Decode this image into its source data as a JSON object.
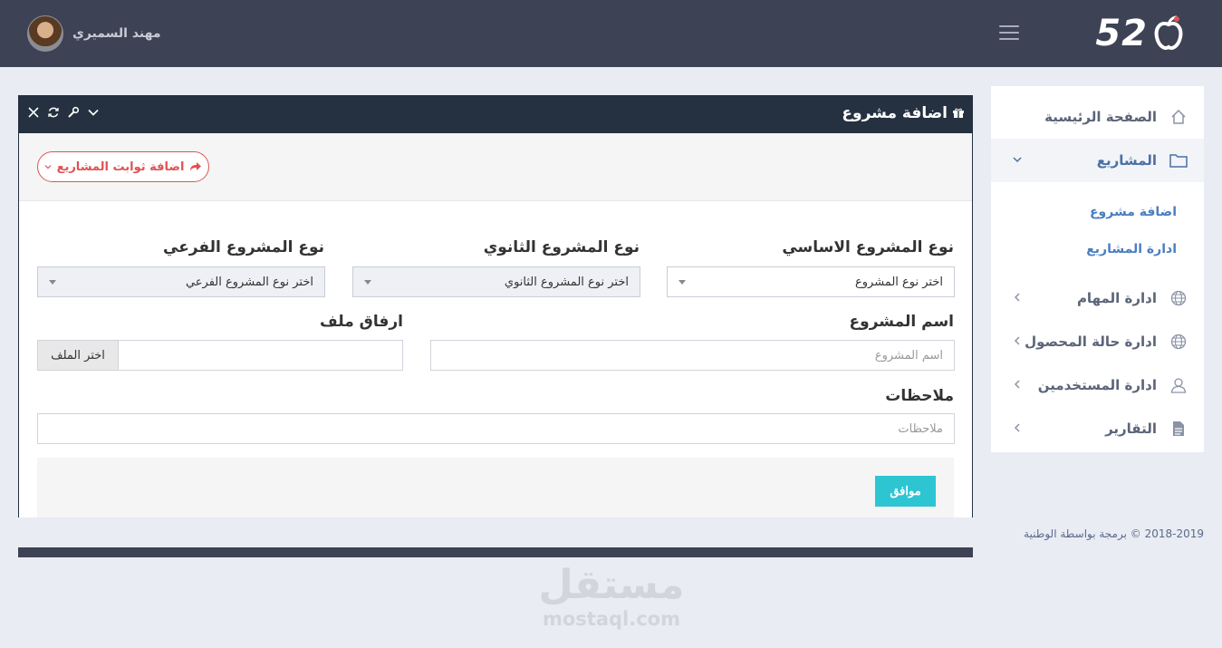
{
  "header": {
    "logo_text": "52",
    "user_name": "مهند السميري"
  },
  "sidebar": {
    "items": [
      {
        "label": "الصفحة الرئيسية",
        "icon": "home-icon"
      },
      {
        "label": "المشاريع",
        "icon": "folder-icon"
      },
      {
        "label": "ادارة المهام",
        "icon": "globe-icon"
      },
      {
        "label": "ادارة حالة المحصول",
        "icon": "globe-icon"
      },
      {
        "label": "ادارة المستخدمين",
        "icon": "user-icon"
      },
      {
        "label": "التقارير",
        "icon": "document-icon"
      }
    ],
    "sub_items": [
      {
        "label": "اضافة مشروع"
      },
      {
        "label": "ادارة المشاريع"
      }
    ]
  },
  "panel": {
    "title": "اضافة مشروع",
    "add_constants_button": "اضافة ثوابت المشاريع",
    "fields": {
      "main_type_label": "نوع المشروع الاساسي",
      "main_type_value": "اختر نوع المشروع",
      "secondary_type_label": "نوع المشروع الثانوي",
      "secondary_type_value": "اختر نوع المشروع الثانوي",
      "sub_type_label": "نوع المشروع الفرعي",
      "sub_type_value": "اختر نوع المشروع الفرعي",
      "project_name_label": "اسم المشروع",
      "project_name_placeholder": "اسم المشروع",
      "attach_label": "ارفاق ملف",
      "attach_button": "اختر الملف",
      "notes_label": "ملاحظات",
      "notes_placeholder": "ملاحظات"
    },
    "submit_button": "موافق"
  },
  "footer": {
    "copyright": "2018-2019 © برمجة بواسطة الوطنية"
  },
  "watermark": {
    "arabic": "مستقل",
    "english": "mostaql.com"
  },
  "colors": {
    "header_bg": "#3e4255",
    "panel_head_bg": "#253140",
    "accent_red": "#e05252",
    "submit_cyan": "#2ec5d3",
    "sidebar_link_blue": "#4a7ec0"
  }
}
